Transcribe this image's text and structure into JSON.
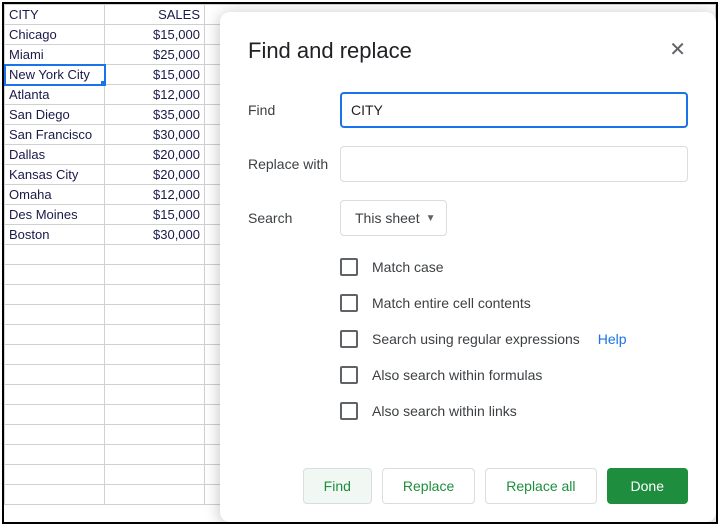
{
  "sheet": {
    "headers": {
      "city": "CITY",
      "sales": "SALES"
    },
    "rows": [
      {
        "city": "Chicago",
        "sales": "$15,000"
      },
      {
        "city": "Miami",
        "sales": "$25,000"
      },
      {
        "city": "New York City",
        "sales": "$15,000"
      },
      {
        "city": "Atlanta",
        "sales": "$12,000"
      },
      {
        "city": "San Diego",
        "sales": "$35,000"
      },
      {
        "city": "San Francisco",
        "sales": "$30,000"
      },
      {
        "city": "Dallas",
        "sales": "$20,000"
      },
      {
        "city": "Kansas City",
        "sales": "$20,000"
      },
      {
        "city": "Omaha",
        "sales": "$12,000"
      },
      {
        "city": "Des Moines",
        "sales": "$15,000"
      },
      {
        "city": "Boston",
        "sales": "$30,000"
      }
    ]
  },
  "dialog": {
    "title": "Find and replace",
    "find_label": "Find",
    "find_value": "CITY",
    "replace_label": "Replace with",
    "replace_value": "",
    "search_label": "Search",
    "search_scope": "This sheet",
    "options": {
      "match_case": "Match case",
      "match_entire": "Match entire cell contents",
      "regex": "Search using regular expressions",
      "regex_help": "Help",
      "formulas": "Also search within formulas",
      "links": "Also search within links"
    },
    "buttons": {
      "find": "Find",
      "replace": "Replace",
      "replace_all": "Replace all",
      "done": "Done"
    }
  }
}
